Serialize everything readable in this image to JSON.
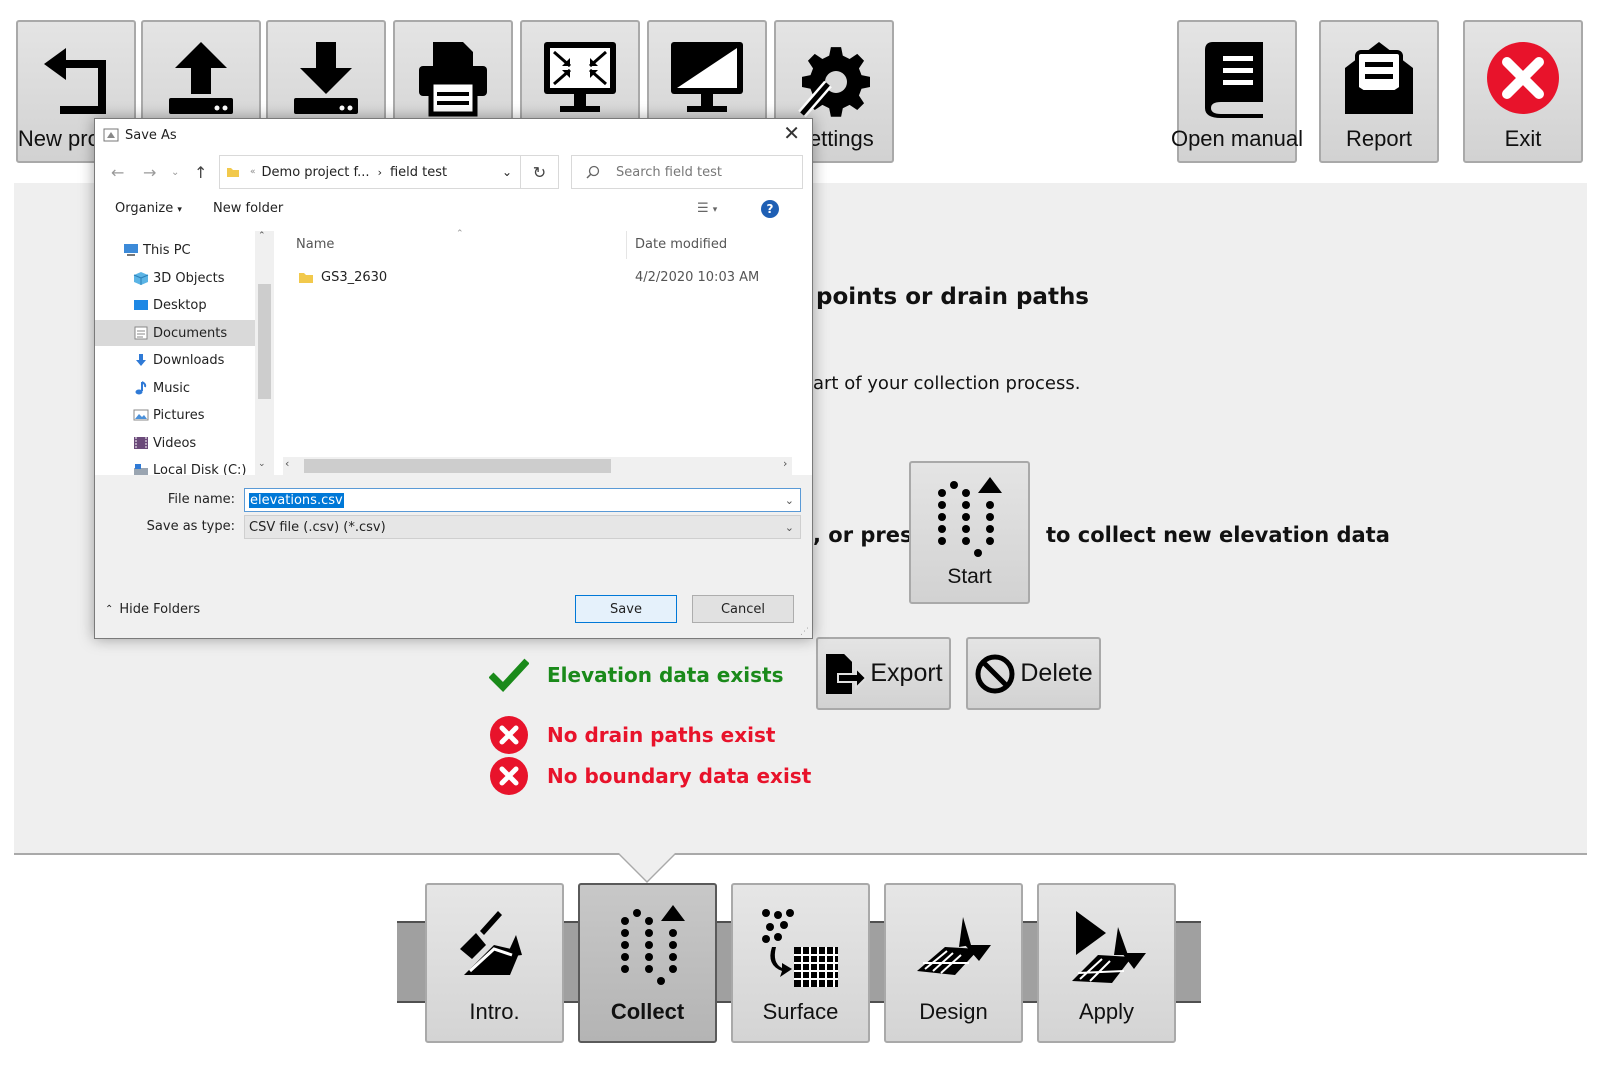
{
  "toolbar": {
    "new_label": "New project",
    "upload_label": "",
    "download_label": "",
    "print_label": "",
    "fit_label": "",
    "display_label": "",
    "settings_label": "Settings",
    "manual_label": "Open manual",
    "report_label": "Report",
    "exit_label": "Exit"
  },
  "panel": {
    "heading": "points or drain paths",
    "body_text": "art of your collection process.",
    "or_press": ", or press",
    "collect_text": "to collect new elevation data",
    "start_label": "Start",
    "status": {
      "elevation": "Elevation data exists",
      "drain": "No drain paths exist",
      "boundary": "No boundary data exist"
    },
    "export_label": "Export",
    "delete_label": "Delete"
  },
  "nav": {
    "items": [
      {
        "label": "Intro."
      },
      {
        "label": "Collect"
      },
      {
        "label": "Surface"
      },
      {
        "label": "Design"
      },
      {
        "label": "Apply"
      }
    ],
    "active": "Collect"
  },
  "dialog": {
    "title": "Save As",
    "breadcrumb": [
      "Demo project f...",
      "field test"
    ],
    "search_placeholder": "Search field test",
    "organize": "Organize",
    "new_folder": "New folder",
    "tree": [
      {
        "label": "This PC"
      },
      {
        "label": "3D Objects"
      },
      {
        "label": "Desktop"
      },
      {
        "label": "Documents"
      },
      {
        "label": "Downloads"
      },
      {
        "label": "Music"
      },
      {
        "label": "Pictures"
      },
      {
        "label": "Videos"
      },
      {
        "label": "Local Disk (C:)"
      }
    ],
    "columns": {
      "name": "Name",
      "date": "Date modified"
    },
    "files": [
      {
        "name": "GS3_2630",
        "date": "4/2/2020 10:03 AM"
      }
    ],
    "file_name_label": "File name:",
    "file_name": "elevations.csv",
    "type_label": "Save as type:",
    "type_value": "CSV file (.csv) (*.csv)",
    "save": "Save",
    "cancel": "Cancel",
    "hide_folders": "Hide Folders"
  },
  "colors": {
    "ok": "#1a8a1a",
    "error": "#e8132b",
    "exit_red": "#e8132b",
    "accent": "#0078d7"
  }
}
